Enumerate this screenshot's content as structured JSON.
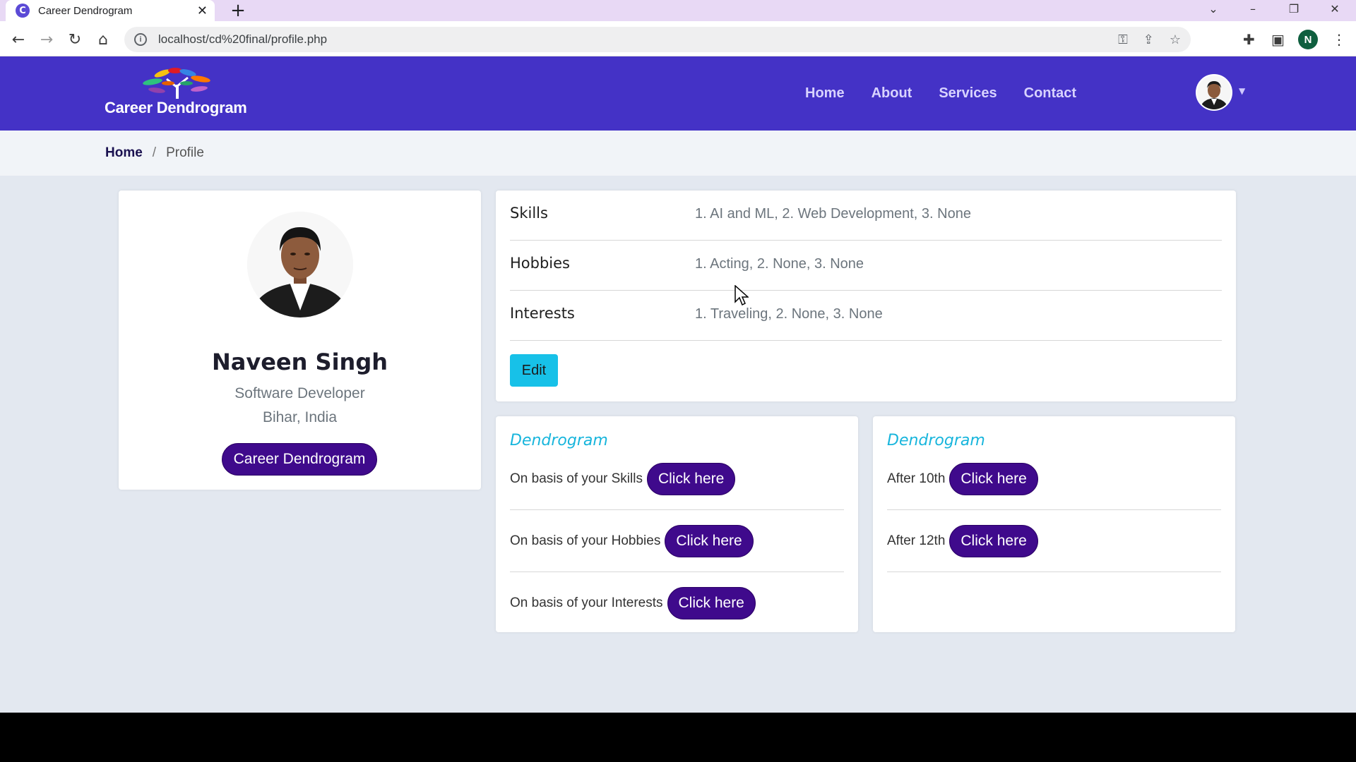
{
  "browser": {
    "tab_title": "Career Dendrogram",
    "tab_favicon_letter": "C",
    "url": "localhost/cd%20final/profile.php",
    "profile_initial": "N"
  },
  "site": {
    "logo_text": "Career Dendrogram",
    "nav": [
      "Home",
      "About",
      "Services",
      "Contact"
    ]
  },
  "breadcrumb": {
    "home": "Home",
    "separator": "/",
    "current": "Profile"
  },
  "profile": {
    "name": "Naveen Singh",
    "role": "Software Developer",
    "location": "Bihar, India",
    "button_label": "Career Dendrogram"
  },
  "info": {
    "rows": [
      {
        "label": "Skills",
        "value": "1. AI and ML, 2. Web Development, 3. None"
      },
      {
        "label": "Hobbies",
        "value": "1. Acting, 2. None, 3. None"
      },
      {
        "label": "Interests",
        "value": "1. Traveling, 2. None, 3. None"
      }
    ],
    "edit_label": "Edit"
  },
  "dendrogram_left": {
    "title": "Dendrogram",
    "rows": [
      {
        "text": "On basis of your Skills",
        "button": "Click here"
      },
      {
        "text": "On basis of your Hobbies",
        "button": "Click here"
      },
      {
        "text": "On basis of your Interests",
        "button": "Click here"
      }
    ]
  },
  "dendrogram_right": {
    "title": "Dendrogram",
    "rows": [
      {
        "text": "After 10th",
        "button": "Click here"
      },
      {
        "text": "After 12th",
        "button": "Click here"
      }
    ]
  },
  "colors": {
    "header_bg": "#4432c6",
    "button_purple": "#3f0a8c",
    "edit_cyan": "#17c1e8",
    "dendro_title": "#17b5dc",
    "page_bg": "#e3e8f0"
  }
}
